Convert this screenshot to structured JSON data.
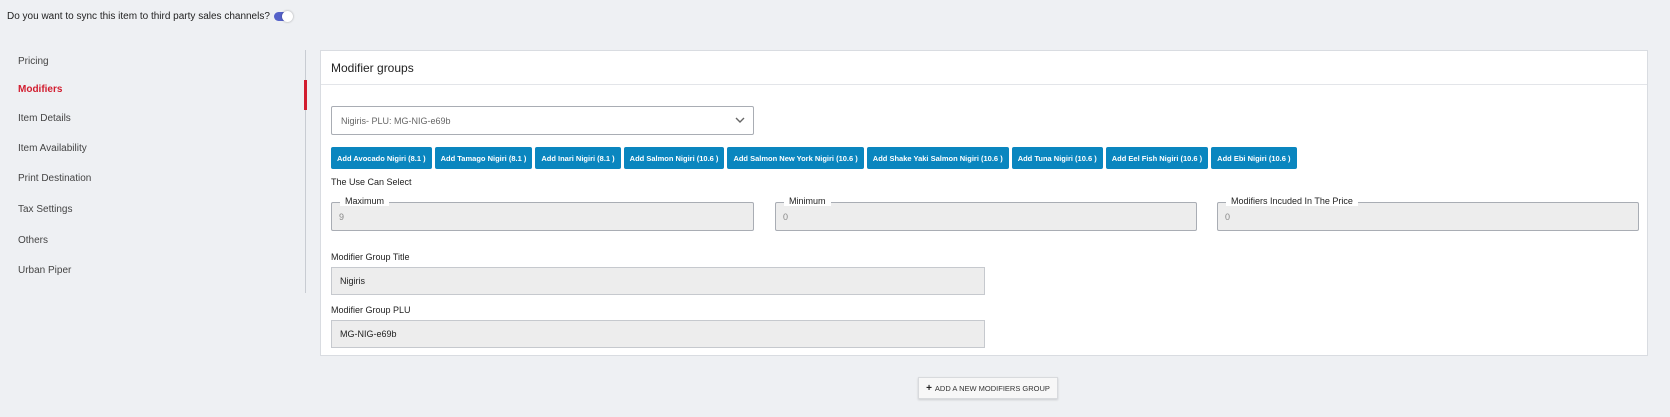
{
  "sync": {
    "question": "Do you want to sync this item to third party sales channels?",
    "enabled": true
  },
  "colors": {
    "accent_red": "#d21d2f",
    "button_blue": "#0a86bf",
    "toggle_blue": "#5562c9"
  },
  "sidebar": {
    "items": [
      {
        "label": "Pricing",
        "active": false
      },
      {
        "label": "Modifiers",
        "active": true
      },
      {
        "label": "Item Details",
        "active": false
      },
      {
        "label": "Item Availability",
        "active": false
      },
      {
        "label": "Print Destination",
        "active": false
      },
      {
        "label": "Tax Settings",
        "active": false
      },
      {
        "label": "Others",
        "active": false
      },
      {
        "label": "Urban Piper",
        "active": false
      }
    ]
  },
  "card": {
    "title": "Modifier groups",
    "select": {
      "value": "Nigiris- PLU: MG-NIG-e69b",
      "icon": "chevron-down-icon"
    },
    "modifier_buttons": [
      "Add Avocado Nigiri (8.1 )",
      "Add Tamago Nigiri (8.1 )",
      "Add Inari Nigiri (8.1 )",
      "Add Salmon Nigiri (10.6 )",
      "Add Salmon New York Nigiri (10.6 )",
      "Add Shake Yaki Salmon Nigiri (10.6 )",
      "Add Tuna Nigiri (10.6 )",
      "Add Eel Fish Nigiri (10.6 )",
      "Add Ebi Nigiri (10.6 )"
    ],
    "select_label": "The Use Can Select",
    "maximum": {
      "label": "Maximum",
      "value": "9"
    },
    "minimum": {
      "label": "Minimum",
      "value": "0"
    },
    "included": {
      "label": "Modifiers Incuded In The Price",
      "value": "0"
    },
    "group_title": {
      "label": "Modifier Group Title",
      "value": "Nigiris"
    },
    "group_plu": {
      "label": "Modifier Group PLU",
      "value": "MG-NIG-e69b"
    }
  },
  "add_group": {
    "icon": "plus-icon",
    "label": "ADD A NEW MODIFIERS GROUP"
  }
}
